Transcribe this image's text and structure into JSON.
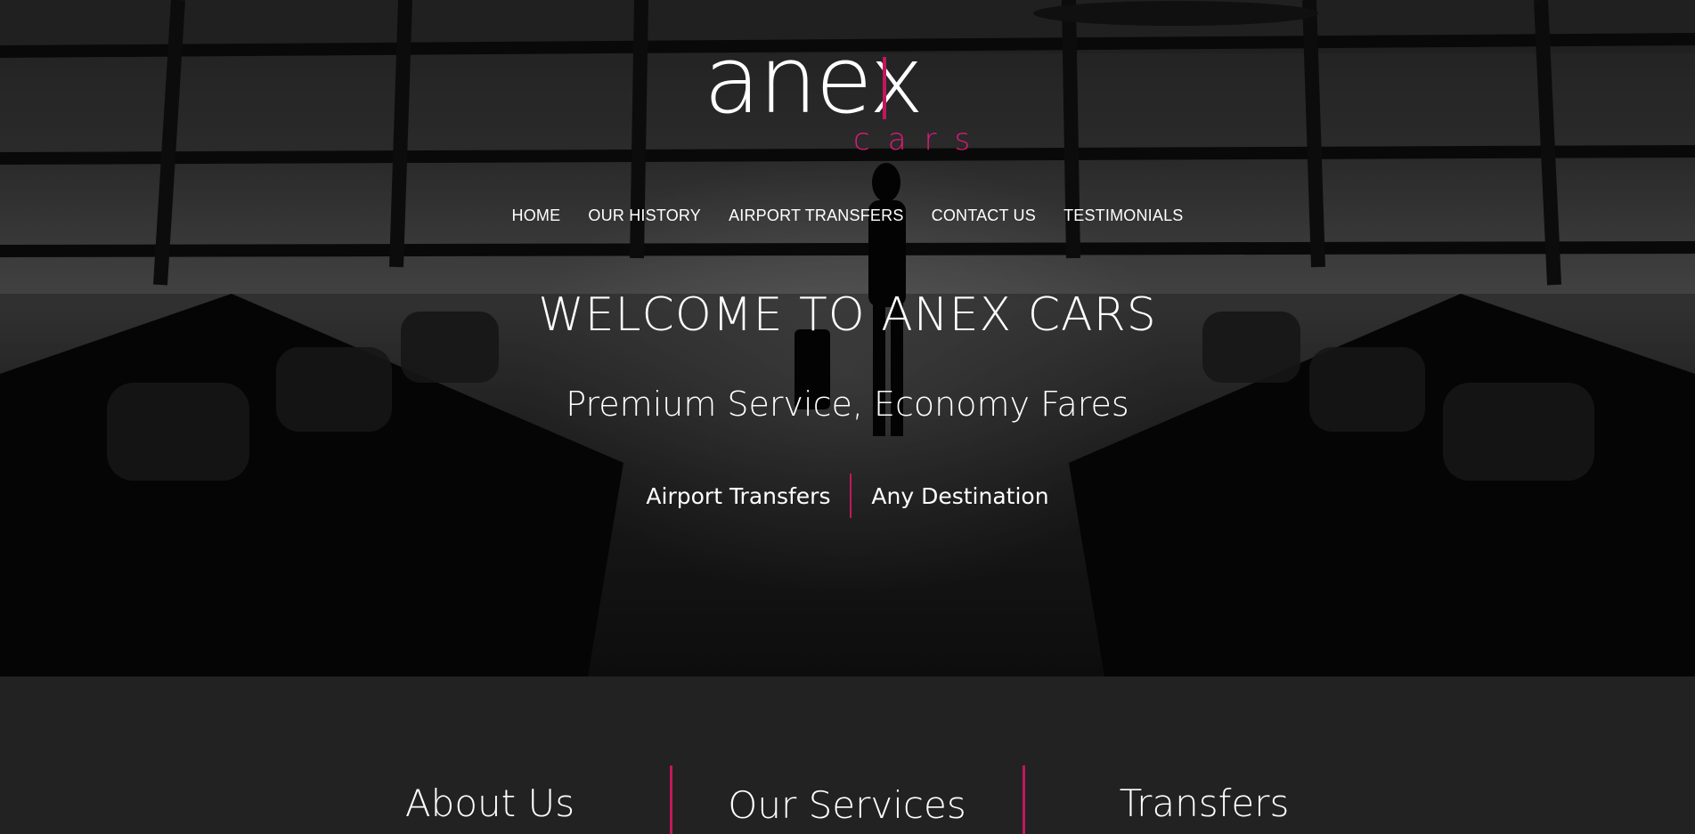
{
  "brand": {
    "logo_word": "anex",
    "logo_sub": "cars",
    "accent_color": "#c2185b"
  },
  "nav": {
    "items": [
      {
        "label": "HOME"
      },
      {
        "label": "OUR HISTORY"
      },
      {
        "label": "AIRPORT TRANSFERS"
      },
      {
        "label": "CONTACT US"
      },
      {
        "label": "TESTIMONIALS"
      }
    ]
  },
  "hero": {
    "title": "WELCOME TO ANEX CARS",
    "subtitle": "Premium Service, Economy Fares",
    "tag_left": "Airport Transfers",
    "tag_right": "Any Destination",
    "background": "airport terminal lounge photo"
  },
  "sections": {
    "columns": [
      {
        "title": "About Us"
      },
      {
        "title": "Our Services"
      },
      {
        "title": "Transfers"
      }
    ]
  }
}
